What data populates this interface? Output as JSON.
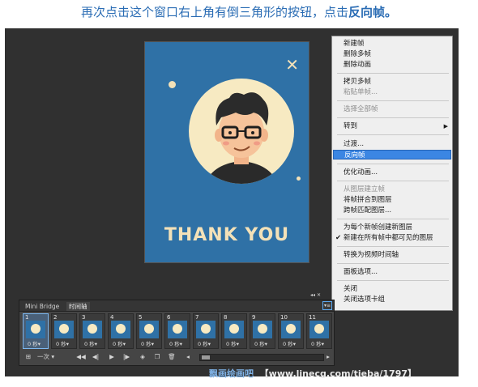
{
  "instruction": {
    "text": "再次点击这个窗口右上角有倒三角形的按钮，点击",
    "bold": "反向帧。"
  },
  "artwork": {
    "title": "THANK YOU",
    "close_glyph": "✕"
  },
  "context_menu": {
    "items": [
      {
        "label": "新建帧"
      },
      {
        "label": "删除多帧"
      },
      {
        "label": "删除动画"
      },
      {
        "label": "拷贝多帧"
      },
      {
        "label": "粘贴单帧..."
      },
      {
        "label": "选择全部帧"
      },
      {
        "label": "转到"
      },
      {
        "label": "过渡..."
      },
      {
        "label": "反向帧"
      },
      {
        "label": "优化动画..."
      },
      {
        "label": "从图层建立帧"
      },
      {
        "label": "将帧拼合到图层"
      },
      {
        "label": "跨帧匹配图层..."
      },
      {
        "label": "为每个新帧创建新图层"
      },
      {
        "label": "新建在所有帧中都可见的图层"
      },
      {
        "label": "转换为视频时间轴"
      },
      {
        "label": "面板选项..."
      },
      {
        "label": "关闭"
      },
      {
        "label": "关闭选项卡组"
      }
    ],
    "highlighted": "反向帧",
    "checked": "新建在所有帧中都可见的图层"
  },
  "timeline": {
    "tabs": [
      "Mini Bridge",
      "时间轴"
    ],
    "active_tab": "时间轴",
    "frames": [
      {
        "number": "1",
        "delay": "0 秒▾"
      },
      {
        "number": "2",
        "delay": "0 秒▾"
      },
      {
        "number": "3",
        "delay": "0 秒▾"
      },
      {
        "number": "4",
        "delay": "0 秒▾"
      },
      {
        "number": "5",
        "delay": "0 秒▾"
      },
      {
        "number": "6",
        "delay": "0 秒▾"
      },
      {
        "number": "7",
        "delay": "0 秒▾"
      },
      {
        "number": "8",
        "delay": "0 秒▾"
      },
      {
        "number": "9",
        "delay": "0 秒▾"
      },
      {
        "number": "10",
        "delay": "0 秒▾"
      },
      {
        "number": "11",
        "delay": "0 秒▾"
      }
    ],
    "selected_frame": "1",
    "loop_option": "一次",
    "menu_button": "▾≡"
  },
  "watermark": "【www.linecg.com/tieba/1797】",
  "watermark_brand": "飘画绘画吧",
  "colors": {
    "instruction_text": "#2a6cb4",
    "menu_highlight": "#3b86e3",
    "card_background": "#2f71a6",
    "workspace": "#303030"
  }
}
